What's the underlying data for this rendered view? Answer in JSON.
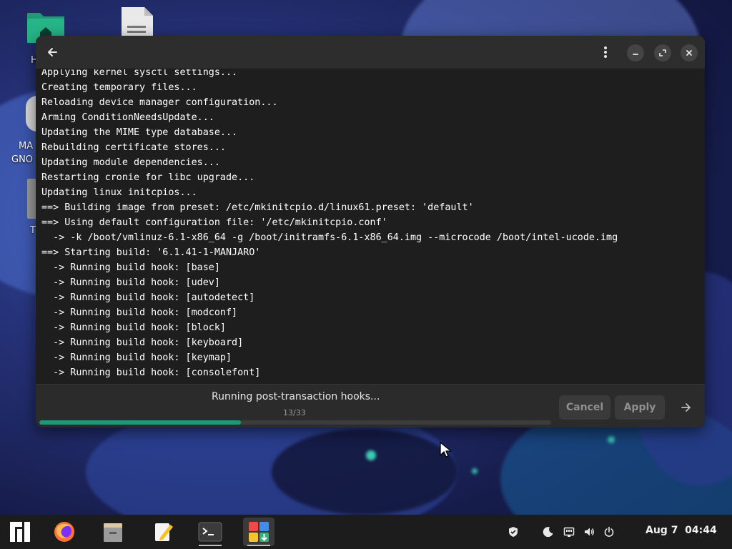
{
  "desktop": {
    "icons": [
      {
        "name": "home-folder"
      },
      {
        "name": "document-file"
      },
      {
        "name": "manjaro-gnome"
      },
      {
        "name": "trash"
      }
    ],
    "label_fragments": [
      "H",
      "MA",
      "GNO",
      "T"
    ]
  },
  "window": {
    "terminal_lines": [
      "Applying kernel sysctl settings...",
      "Creating temporary files...",
      "Reloading device manager configuration...",
      "Arming ConditionNeedsUpdate...",
      "Updating the MIME type database...",
      "Rebuilding certificate stores...",
      "Updating module dependencies...",
      "Restarting cronie for libc upgrade...",
      "Updating linux initcpios...",
      "==> Building image from preset: /etc/mkinitcpio.d/linux61.preset: 'default'",
      "==> Using default configuration file: '/etc/mkinitcpio.conf'",
      "  -> -k /boot/vmlinuz-6.1-x86_64 -g /boot/initramfs-6.1-x86_64.img --microcode /boot/intel-ucode.img",
      "==> Starting build: '6.1.41-1-MANJARO'",
      "  -> Running build hook: [base]",
      "  -> Running build hook: [udev]",
      "  -> Running build hook: [autodetect]",
      "  -> Running build hook: [modconf]",
      "  -> Running build hook: [block]",
      "  -> Running build hook: [keyboard]",
      "  -> Running build hook: [keymap]",
      "  -> Running build hook: [consolefont]"
    ],
    "status": "Running post-transaction hooks...",
    "progress": {
      "current": 13,
      "total": 33,
      "label": "13/33"
    },
    "buttons": {
      "cancel": "Cancel",
      "apply": "Apply"
    }
  },
  "taskbar": {
    "apps": [
      "manjaro-menu",
      "firefox",
      "files",
      "text-editor",
      "terminal",
      "software-manager"
    ],
    "tray": [
      "shield-icon",
      "night-light-icon",
      "network-icon",
      "volume-icon",
      "power-icon"
    ],
    "clock": "Aug 7  04:44"
  },
  "colors": {
    "accent": "#1b9a78",
    "window_bg": "#1e1e1e",
    "headerbar": "#2d2d2d",
    "taskbar": "#1c1c1c"
  }
}
